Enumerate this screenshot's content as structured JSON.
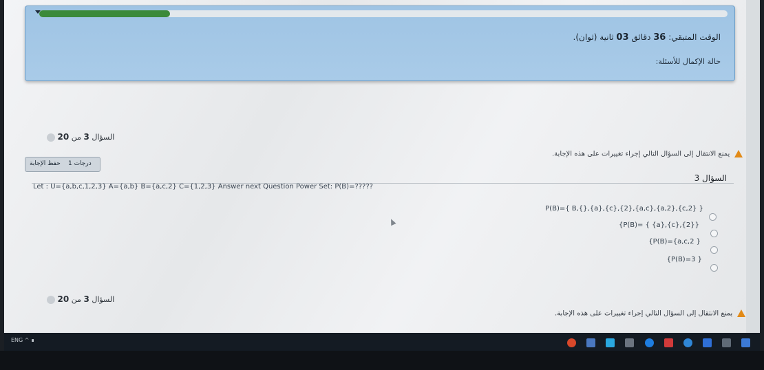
{
  "timer": {
    "label_prefix": "الوقت المتبقي:",
    "minutes": "36",
    "minutes_unit": "دقائق",
    "seconds": "03",
    "seconds_unit": "ثانية (ثوان).",
    "save_state": "حالة الإكمال للأسئلة:",
    "progress_fraction": 0.19
  },
  "nav_top": {
    "label": "السؤال",
    "current": "3",
    "of": "من",
    "total": "20"
  },
  "nav_bottom": {
    "label": "السؤال",
    "current": "3",
    "of": "من",
    "total": "20"
  },
  "warning_top": "يمنع الانتقال إلى السؤال التالي إجراء تغييرات على هذه الإجابة.",
  "warning_bottom": "يمنع الانتقال إلى السؤال التالي إجراء تغييرات على هذه الإجابة.",
  "flag": {
    "grade": "1 درجات",
    "save_label": "حفظ الإجابة"
  },
  "question": {
    "number_label": "السؤال 3",
    "text": "Let : U={a,b,c,1,2,3} A={a,b} B={a,c,2} C={1,2,3} Answer next Question Power Set: P(B)=?????"
  },
  "options": [
    "P(B)={ B,{},{a},{c},{2},{a,c},{a,2},{c,2} }",
    "{P(B)= { {a},{c},{2}}",
    "{P(B)={a,c,2 }",
    "{P(B)=3 }"
  ],
  "taskbar": {
    "system_text": "ENG  ^  ∎"
  },
  "colors": {
    "accent": "#9fc4e4",
    "progress": "#3b8a3a",
    "warning": "#e28a17",
    "taskbar": "#141b23"
  },
  "icons": [
    "warning-icon",
    "radio-icon",
    "chrome-icon",
    "explorer-icon",
    "edge-icon",
    "store-icon"
  ]
}
